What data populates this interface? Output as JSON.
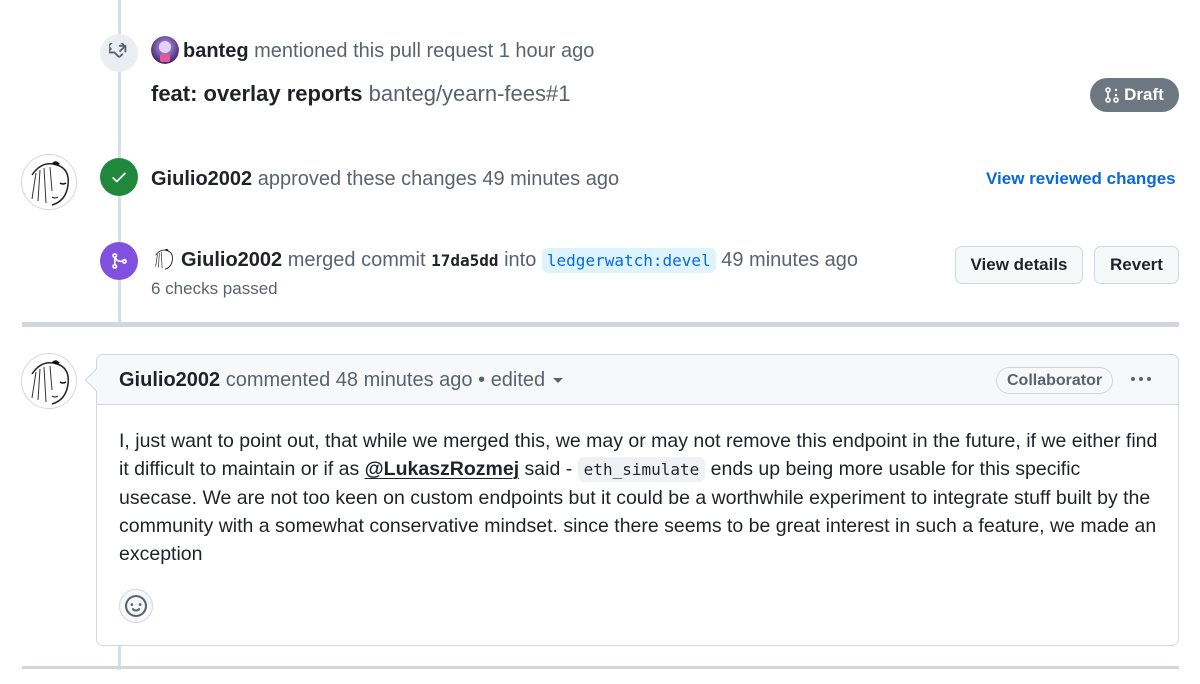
{
  "mention_event": {
    "icon": "cross-reference-icon",
    "user": "banteg",
    "action": "mentioned this pull request",
    "time": "1 hour ago",
    "ref_title": "feat: overlay reports",
    "ref_repo": "banteg/yearn-fees#1",
    "ref_state": "Draft",
    "ref_state_icon": "git-pull-request-draft-icon"
  },
  "review_event": {
    "icon": "check-icon",
    "user": "Giulio2002",
    "action": "approved these changes",
    "time": "49 minutes ago",
    "link": "View reviewed changes"
  },
  "merge_event": {
    "icon": "git-merge-icon",
    "user": "Giulio2002",
    "action": "merged commit",
    "commit": "17da5dd",
    "into": "into",
    "branch": "ledgerwatch:devel",
    "time": "49 minutes ago",
    "checks": "6 checks passed",
    "buttons": {
      "details": "View details",
      "revert": "Revert"
    }
  },
  "comment": {
    "user": "Giulio2002",
    "action": "commented",
    "time": "48 minutes ago",
    "separator": "•",
    "edited": "edited",
    "role_badge": "Collaborator",
    "body_part1": "I, just want to point out, that while we merged this, we may or may not remove this endpoint in the future, if we either find it difficult to maintain or if as ",
    "mention": "@LukaszRozmej",
    "body_part2": " said - ",
    "code": "eth_simulate",
    "body_part3": " ends up being more usable for this specific usecase. We are not too keen on custom endpoints but it could be a worthwhile experiment to integrate stuff built by the community with a somewhat conservative mindset. since there seems to be great interest in such a feature, we made an exception"
  },
  "colors": {
    "approve": "#1f883d",
    "merge": "#8250df",
    "link": "#0969da",
    "draft": "#6e7781"
  }
}
